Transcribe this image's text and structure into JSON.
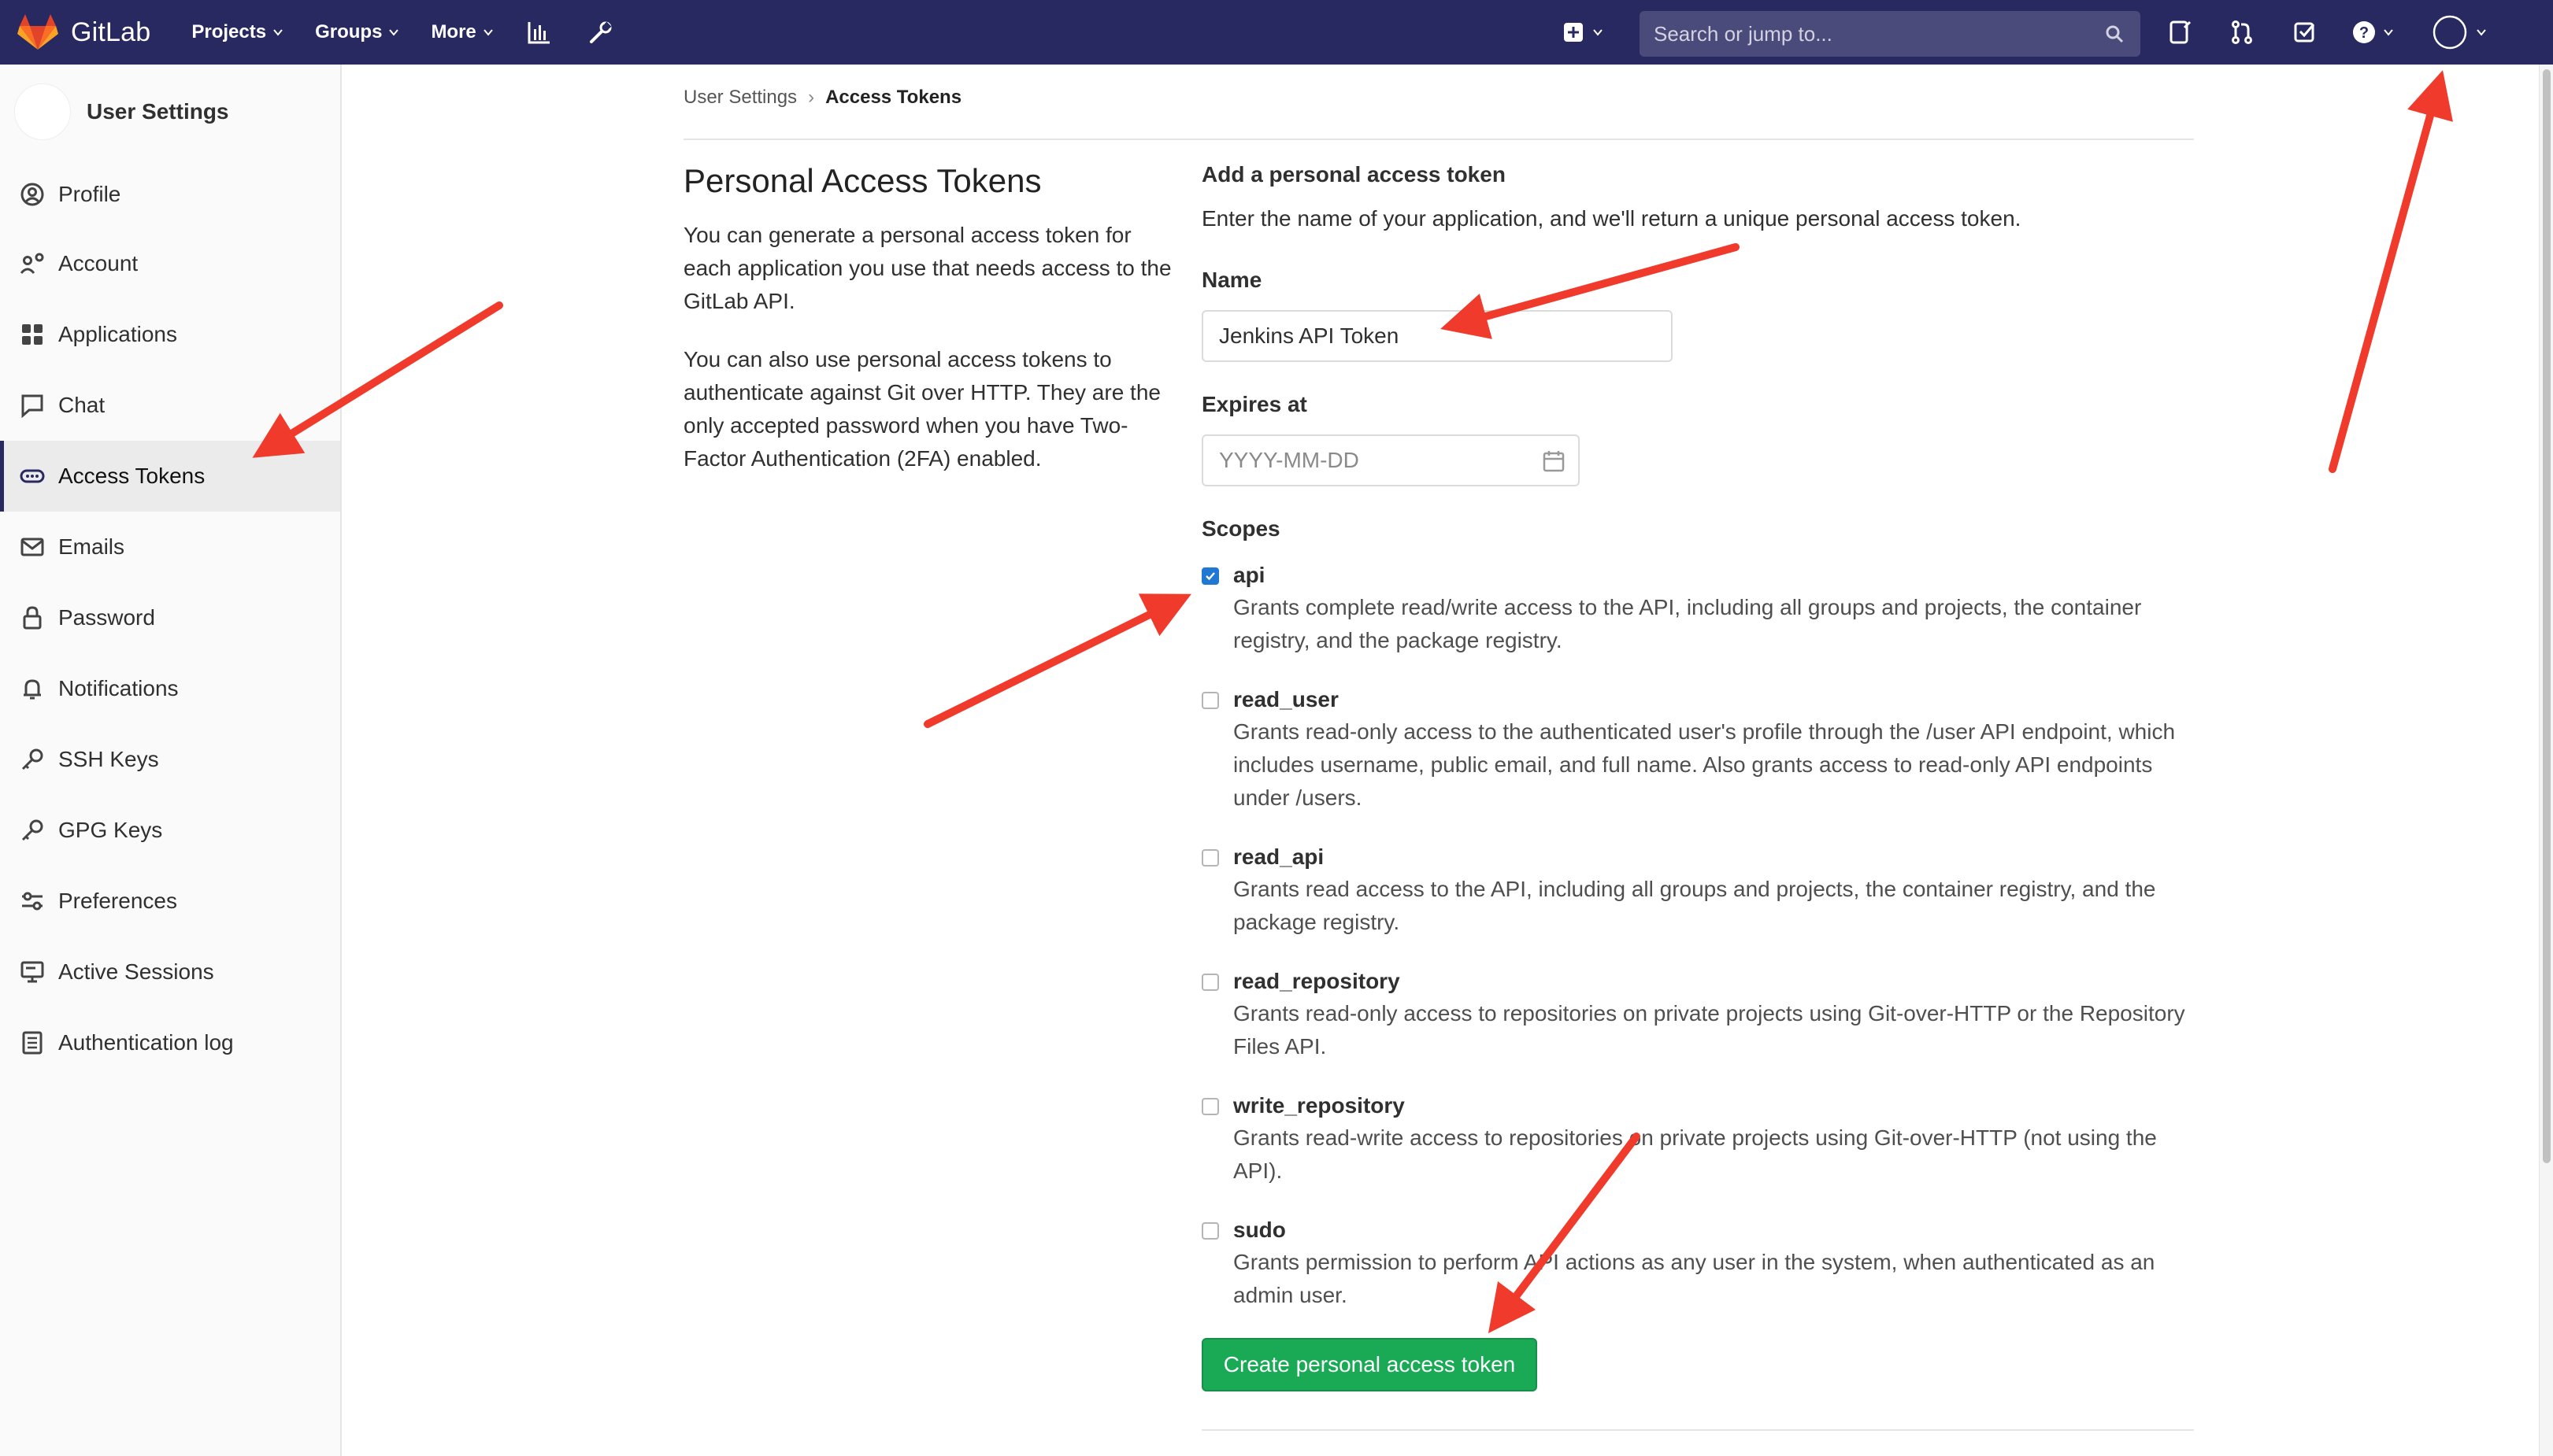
{
  "navbar": {
    "brand": "GitLab",
    "menu": [
      {
        "label": "Projects"
      },
      {
        "label": "Groups"
      },
      {
        "label": "More"
      }
    ],
    "icons": [
      "chart-icon",
      "wrench-icon"
    ],
    "search_placeholder": "Search or jump to...",
    "right_icons": [
      "plus-square-icon",
      "issues-icon",
      "merge-request-icon",
      "todo-icon",
      "help-icon",
      "user-avatar-icon"
    ]
  },
  "sidebar": {
    "title": "User Settings",
    "items": [
      {
        "label": "Profile",
        "icon": "profile-icon"
      },
      {
        "label": "Account",
        "icon": "account-icon"
      },
      {
        "label": "Applications",
        "icon": "applications-icon"
      },
      {
        "label": "Chat",
        "icon": "chat-icon"
      },
      {
        "label": "Access Tokens",
        "icon": "token-icon",
        "active": true
      },
      {
        "label": "Emails",
        "icon": "mail-icon"
      },
      {
        "label": "Password",
        "icon": "lock-icon"
      },
      {
        "label": "Notifications",
        "icon": "bell-icon"
      },
      {
        "label": "SSH Keys",
        "icon": "key-icon"
      },
      {
        "label": "GPG Keys",
        "icon": "key-icon"
      },
      {
        "label": "Preferences",
        "icon": "preferences-icon"
      },
      {
        "label": "Active Sessions",
        "icon": "monitor-icon"
      },
      {
        "label": "Authentication log",
        "icon": "log-icon"
      }
    ]
  },
  "breadcrumb": {
    "parent": "User Settings",
    "separator": "›",
    "current": "Access Tokens"
  },
  "intro": {
    "title": "Personal Access Tokens",
    "para1": "You can generate a personal access token for each application you use that needs access to the GitLab API.",
    "para2": "You can also use personal access tokens to authenticate against Git over HTTP. They are the only accepted password when you have Two-Factor Authentication (2FA) enabled."
  },
  "form": {
    "heading": "Add a personal access token",
    "subheading": "Enter the name of your application, and we'll return a unique personal access token.",
    "name_label": "Name",
    "name_value": "Jenkins API Token",
    "expires_label": "Expires at",
    "expires_placeholder": "YYYY-MM-DD",
    "scopes_label": "Scopes",
    "scopes": [
      {
        "name": "api",
        "checked": true,
        "desc": "Grants complete read/write access to the API, including all groups and projects, the container registry, and the package registry."
      },
      {
        "name": "read_user",
        "checked": false,
        "desc": "Grants read-only access to the authenticated user's profile through the /user API endpoint, which includes username, public email, and full name. Also grants access to read-only API endpoints under /users."
      },
      {
        "name": "read_api",
        "checked": false,
        "desc": "Grants read access to the API, including all groups and projects, the container registry, and the package registry."
      },
      {
        "name": "read_repository",
        "checked": false,
        "desc": "Grants read-only access to repositories on private projects using Git-over-HTTP or the Repository Files API."
      },
      {
        "name": "write_repository",
        "checked": false,
        "desc": "Grants read-write access to repositories on private projects using Git-over-HTTP (not using the API)."
      },
      {
        "name": "sudo",
        "checked": false,
        "desc": "Grants permission to perform API actions as any user in the system, when authenticated as an admin user."
      }
    ],
    "submit_label": "Create personal access token"
  },
  "colors": {
    "navbar": "#292961",
    "submit": "#1aaa55",
    "checkbox_checked": "#1f78d1",
    "annotation_arrow": "#f03a2b"
  }
}
